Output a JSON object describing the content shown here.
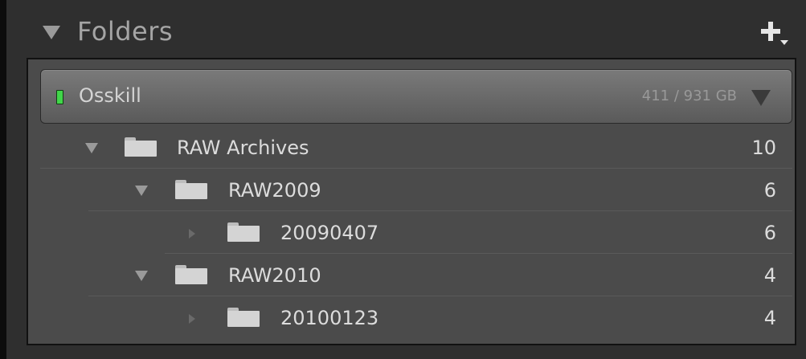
{
  "panel": {
    "title": "Folders",
    "add_icon": "plus-icon"
  },
  "volume": {
    "name": "Osskill",
    "usage": "411 / 931 GB",
    "status_color": "#41d64a"
  },
  "folders": [
    {
      "name": "RAW Archives",
      "count": "10",
      "expanded": true,
      "depth": 0
    },
    {
      "name": "RAW2009",
      "count": "6",
      "expanded": true,
      "depth": 1
    },
    {
      "name": "20090407",
      "count": "6",
      "expanded": false,
      "depth": 2
    },
    {
      "name": "RAW2010",
      "count": "4",
      "expanded": true,
      "depth": 1
    },
    {
      "name": "20100123",
      "count": "4",
      "expanded": false,
      "depth": 2
    }
  ]
}
